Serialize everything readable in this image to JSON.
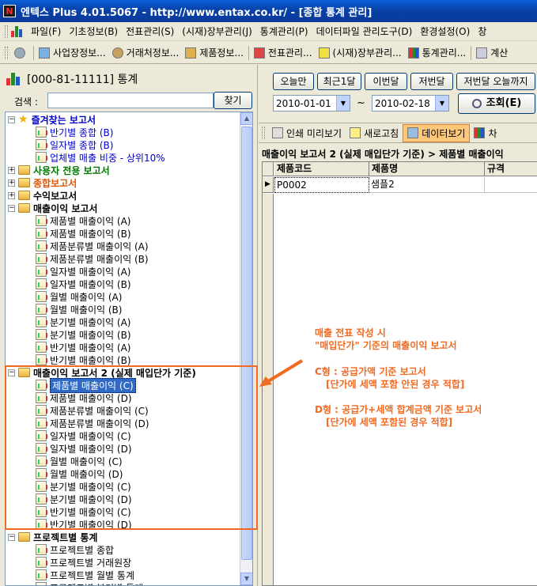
{
  "window": {
    "title": "엔텍스 Plus 4.01.5067 - http://www.entax.co.kr/ - [종합 통계 관리]",
    "app_icon_letter": "N"
  },
  "menu": [
    {
      "label": "파일(F)"
    },
    {
      "label": "기초정보(B)"
    },
    {
      "label": "전표관리(S)"
    },
    {
      "label": "(시재)장부관리(J)"
    },
    {
      "label": "통계관리(P)"
    },
    {
      "label": "데이터파일 관리도구(D)"
    },
    {
      "label": "환경설정(O)"
    },
    {
      "label": "창"
    }
  ],
  "toolbar": [
    {
      "label": "사업장정보...",
      "icon": "building-icon"
    },
    {
      "label": "거래처정보...",
      "icon": "person-icon"
    },
    {
      "label": "제품정보...",
      "icon": "box-icon"
    },
    {
      "label": "전표관리...",
      "icon": "calendar-icon"
    },
    {
      "label": "(시재)장부관리...",
      "icon": "book-icon"
    },
    {
      "label": "통계관리...",
      "icon": "chart-icon"
    },
    {
      "label": "계산",
      "icon": "calculator-icon"
    }
  ],
  "left": {
    "title": "[000-81-11111] 통계",
    "search_label": "검색 :",
    "search_value": "",
    "search_button": "찾기",
    "tree": [
      {
        "level": 0,
        "expander": "−",
        "icon": "star",
        "label": "즐겨찾는 보고서",
        "color": "#0000cc",
        "bold": true
      },
      {
        "level": 1,
        "icon": "report",
        "label": "반기별 종합 (B)",
        "color": "#0000cc"
      },
      {
        "level": 1,
        "icon": "report",
        "label": "일자별 종합 (B)",
        "color": "#0000cc"
      },
      {
        "level": 1,
        "icon": "report",
        "label": "업체별 매출 비중 - 상위10%",
        "color": "#0000cc"
      },
      {
        "level": 0,
        "expander": "+",
        "icon": "folder",
        "label": "사용자 전용 보고서",
        "color": "#007700",
        "bold": true
      },
      {
        "level": 0,
        "expander": "+",
        "icon": "folder",
        "label": "종합보고서",
        "color": "#dd5500",
        "bold": true
      },
      {
        "level": 0,
        "expander": "+",
        "icon": "folder",
        "label": "수익보고서",
        "color": "#000000",
        "bold": true
      },
      {
        "level": 0,
        "expander": "−",
        "icon": "folder",
        "label": "매출이익 보고서",
        "color": "#000000",
        "bold": true
      },
      {
        "level": 1,
        "icon": "report",
        "label": "제품별 매출이익 (A)"
      },
      {
        "level": 1,
        "icon": "report",
        "label": "제품별 매출이익 (B)"
      },
      {
        "level": 1,
        "icon": "report",
        "label": "제품분류별 매출이익 (A)"
      },
      {
        "level": 1,
        "icon": "report",
        "label": "제품분류별 매출이익 (B)"
      },
      {
        "level": 1,
        "icon": "report",
        "label": "일자별 매출이익 (A)"
      },
      {
        "level": 1,
        "icon": "report",
        "label": "일자별 매출이익 (B)"
      },
      {
        "level": 1,
        "icon": "report",
        "label": "월별 매출이익 (A)"
      },
      {
        "level": 1,
        "icon": "report",
        "label": "월별 매출이익 (B)"
      },
      {
        "level": 1,
        "icon": "report",
        "label": "분기별 매출이익 (A)"
      },
      {
        "level": 1,
        "icon": "report",
        "label": "분기별 매출이익 (B)"
      },
      {
        "level": 1,
        "icon": "report",
        "label": "반기별 매출이익 (A)"
      },
      {
        "level": 1,
        "icon": "report",
        "label": "반기별 매출이익 (B)"
      },
      {
        "level": 0,
        "expander": "−",
        "icon": "folder",
        "label": "매출이익 보고서 2 (실제 매입단가 기준)",
        "color": "#000000",
        "bold": true
      },
      {
        "level": 1,
        "icon": "report",
        "label": "제품별 매출이익 (C)",
        "selected": true
      },
      {
        "level": 1,
        "icon": "report",
        "label": "제품별 매출이익 (D)"
      },
      {
        "level": 1,
        "icon": "report",
        "label": "제품분류별 매출이익 (C)"
      },
      {
        "level": 1,
        "icon": "report",
        "label": "제품분류별 매출이익 (D)"
      },
      {
        "level": 1,
        "icon": "report",
        "label": "일자별 매출이익 (C)"
      },
      {
        "level": 1,
        "icon": "report",
        "label": "일자별 매출이익 (D)"
      },
      {
        "level": 1,
        "icon": "report",
        "label": "월별 매출이익 (C)"
      },
      {
        "level": 1,
        "icon": "report",
        "label": "월별 매출이익 (D)"
      },
      {
        "level": 1,
        "icon": "report",
        "label": "분기별 매출이익 (C)"
      },
      {
        "level": 1,
        "icon": "report",
        "label": "분기별 매출이익 (D)"
      },
      {
        "level": 1,
        "icon": "report",
        "label": "반기별 매출이익 (C)"
      },
      {
        "level": 1,
        "icon": "report",
        "label": "반기별 매출이익 (D)"
      },
      {
        "level": 0,
        "expander": "−",
        "icon": "folder",
        "label": "프로젝트별 통계",
        "color": "#000000",
        "bold": true
      },
      {
        "level": 1,
        "icon": "report",
        "label": "프로젝트별 종합"
      },
      {
        "level": 1,
        "icon": "report",
        "label": "프로젝트별 거래원장"
      },
      {
        "level": 1,
        "icon": "report",
        "label": "프로젝트별 월별 통계"
      },
      {
        "level": 1,
        "icon": "report",
        "label": "프로젝트별 분기별 통계"
      }
    ]
  },
  "right": {
    "quick_buttons": [
      "오늘만",
      "최근1달",
      "이번달",
      "저번달",
      "저번달 오늘까지"
    ],
    "date_from": "2010-01-01",
    "date_to": "2010-02-18",
    "tilde": "~",
    "query_button": "조회(E)",
    "toolbar2": [
      {
        "label": "인쇄 미리보기",
        "icon": "print-preview-icon"
      },
      {
        "label": "새로고침",
        "icon": "refresh-icon"
      },
      {
        "label": "데이터보기",
        "icon": "data-view-icon",
        "active": true
      },
      {
        "label": "차",
        "icon": "chart-icon"
      }
    ],
    "breadcrumb": "매출이익 보고서 2 (실제 매입단가 기준) > 제품별 매출이익",
    "grid": {
      "columns": [
        "제품코드",
        "제품명",
        "규격"
      ],
      "rows": [
        [
          "P0002",
          "샘플2",
          ""
        ]
      ]
    }
  },
  "annotation": {
    "line1": "매출 전표 작성 시",
    "line2": "\"매입단가\" 기준의 매출이익 보고서",
    "c_title": "C형 : 공급가액 기준 보고서",
    "c_desc": "[단가에 세액 포함 안된 경우 적합]",
    "d_title": "D형 : 공급가+세액 합계금액 기준 보고서",
    "d_desc": "[단가에 세액 포함된 경우 적합]",
    "color": "#f26a21"
  }
}
